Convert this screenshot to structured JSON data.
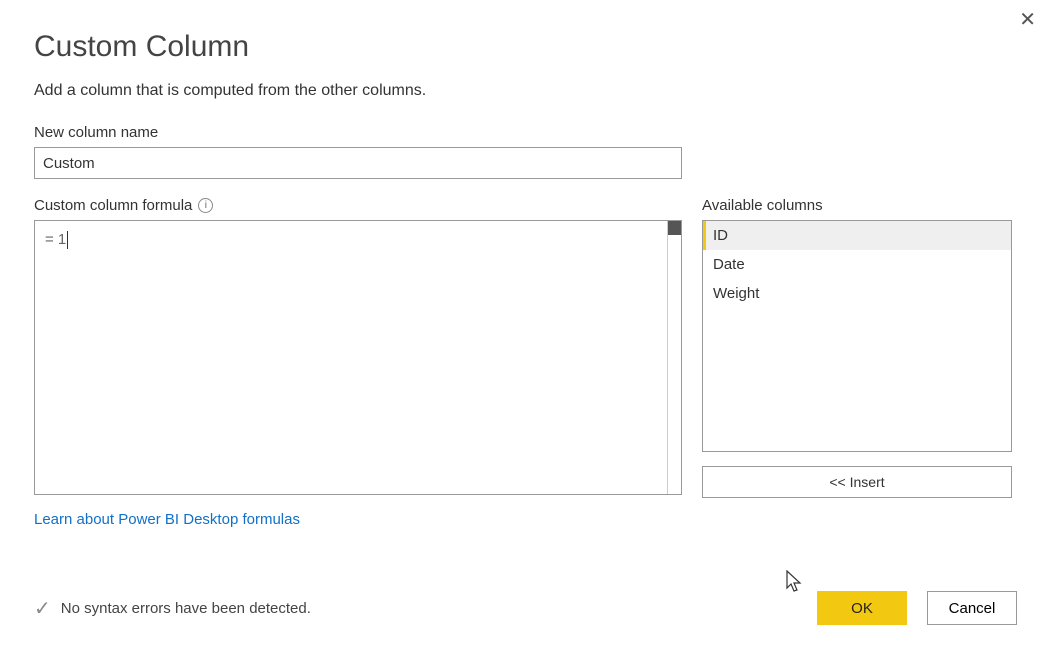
{
  "dialog": {
    "title": "Custom Column",
    "subtitle": "Add a column that is computed from the other columns.",
    "close_label": "✕"
  },
  "name_field": {
    "label": "New column name",
    "value": "Custom"
  },
  "formula_field": {
    "label": "Custom column formula",
    "value": "= 1"
  },
  "available": {
    "label": "Available columns",
    "items": [
      "ID",
      "Date",
      "Weight"
    ],
    "selected_index": 0
  },
  "insert_button": "<< Insert",
  "learn_link": "Learn about Power BI Desktop formulas",
  "status": {
    "message": "No syntax errors have been detected."
  },
  "buttons": {
    "ok": "OK",
    "cancel": "Cancel"
  },
  "colors": {
    "accent": "#f2c811",
    "link": "#1170c9"
  }
}
